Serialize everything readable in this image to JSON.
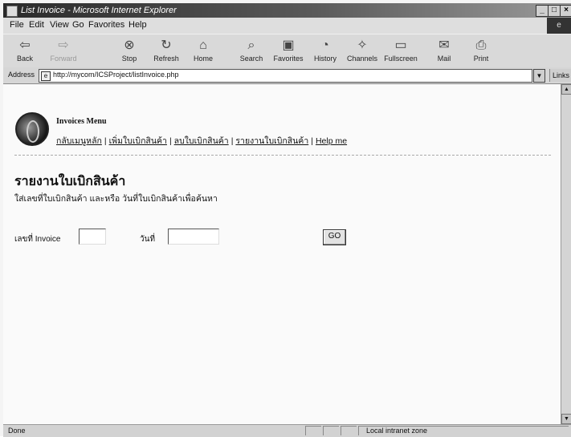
{
  "window": {
    "title": "List Invoice - Microsoft Internet Explorer"
  },
  "menubar": {
    "items": [
      "File",
      "Edit",
      "View",
      "Go",
      "Favorites",
      "Help"
    ]
  },
  "toolbar": {
    "buttons": [
      {
        "label": "Back",
        "icon": "back-arrow-icon"
      },
      {
        "label": "Forward",
        "icon": "forward-arrow-icon"
      },
      {
        "label": "Stop",
        "icon": "stop-icon"
      },
      {
        "label": "Refresh",
        "icon": "refresh-icon"
      },
      {
        "label": "Home",
        "icon": "home-icon"
      },
      {
        "label": "Search",
        "icon": "search-icon"
      },
      {
        "label": "Favorites",
        "icon": "favorites-icon"
      },
      {
        "label": "History",
        "icon": "history-icon"
      },
      {
        "label": "Channels",
        "icon": "channels-icon"
      },
      {
        "label": "Fullscreen",
        "icon": "fullscreen-icon"
      },
      {
        "label": "Mail",
        "icon": "mail-icon"
      },
      {
        "label": "Print",
        "icon": "print-icon"
      }
    ]
  },
  "addressbar": {
    "label": "Address",
    "url": "http://mycom/ICSProject/listInvoice.php",
    "links_label": "Links"
  },
  "page": {
    "menu_title": "Invoices Menu",
    "nav_links": [
      "กลับเมนูหลัก",
      "เพิ่มใบเบิกสินค้า",
      "ลบใบเบิกสินค้า",
      "รายงานใบเบิกสินค้า",
      "Help me"
    ],
    "heading": "รายงานใบเบิกสินค้า",
    "instructions": "ใส่เลขที่ใบเบิกสินค้า และหรือ วันที่ใบเบิกสินค้าเพื่อค้นหา",
    "invoice_label": "เลขที่ Invoice",
    "invoice_value": "",
    "date_label": "วันที่",
    "date_value": "",
    "go_label": "GO"
  },
  "statusbar": {
    "status": "Done",
    "zone": "Local intranet zone"
  }
}
